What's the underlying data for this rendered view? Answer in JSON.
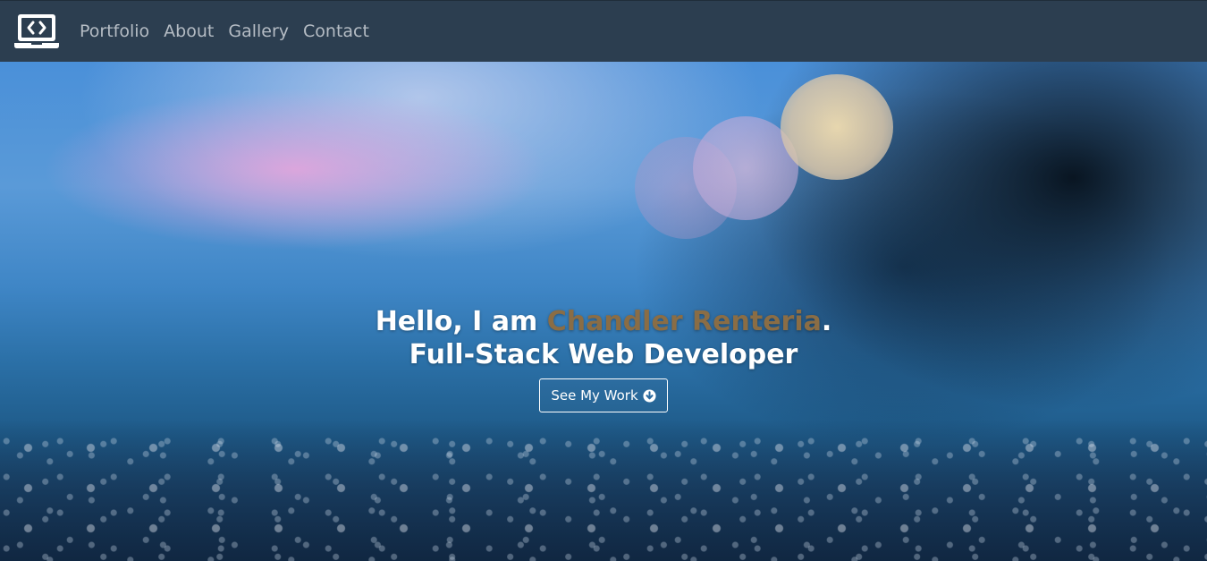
{
  "nav": {
    "logo_icon": "laptop-code-icon",
    "links": [
      {
        "label": "Portfolio"
      },
      {
        "label": "About"
      },
      {
        "label": "Gallery"
      },
      {
        "label": "Contact"
      }
    ]
  },
  "hero": {
    "greeting": "Hello, I am ",
    "name": "Chandler Renteria",
    "punctuation": ".",
    "title": "Full-Stack Web Developer",
    "cta_label": "See My Work",
    "cta_icon": "arrow-circle-down-icon"
  },
  "colors": {
    "navbar_bg": "#2c3e50",
    "nav_link": "#b5bcc4",
    "name_accent": "#8a6d45",
    "hero_text": "#ffffff"
  }
}
